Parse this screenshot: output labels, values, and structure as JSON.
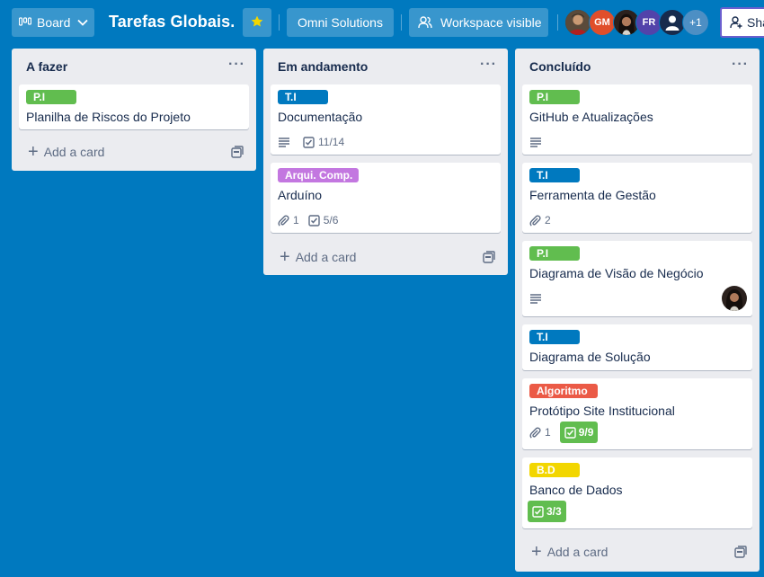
{
  "colors": {
    "board_bg": "#0079bf",
    "label_green": "#61bd4f",
    "label_blue": "#0079bf",
    "label_purple": "#c377e0",
    "label_red": "#eb5a46",
    "label_yellow": "#f2d600"
  },
  "header": {
    "view_label": "Board",
    "view_icon": "board-icon",
    "title": "Tarefas Globais.",
    "star_icon": "star-icon",
    "workspace": "Omni Solutions",
    "visibility": "Workspace visible",
    "visibility_icon": "people-icon",
    "members": [
      "GM",
      "FR"
    ],
    "more_members": "+1",
    "share": "Share"
  },
  "lists": [
    {
      "title": "A fazer",
      "add_card": "Add a card",
      "cards": [
        {
          "label": "P.I",
          "title": "Planilha de Riscos do Projeto"
        }
      ]
    },
    {
      "title": "Em andamento",
      "add_card": "Add a card",
      "cards": [
        {
          "label": "T.I",
          "title": "Documentação",
          "checklist": "11/14"
        },
        {
          "label": "Arqui. Comp.",
          "title": "Arduíno",
          "attachments": "1",
          "checklist": "5/6"
        }
      ]
    },
    {
      "title": "Concluído",
      "add_card": "Add a card",
      "cards": [
        {
          "label": "P.I",
          "title": "GitHub e Atualizações"
        },
        {
          "label": "T.I",
          "title": "Ferramenta de Gestão",
          "attachments": "2"
        },
        {
          "label": "P.I",
          "title": "Diagrama de Visão de Negócio"
        },
        {
          "label": "T.I",
          "title": "Diagrama de Solução"
        },
        {
          "label": "Algoritmo",
          "title": "Protótipo Site Institucional",
          "attachments": "1",
          "checklist": "9/9"
        },
        {
          "label": "B.D",
          "title": "Banco de Dados",
          "checklist": "3/3"
        }
      ]
    }
  ]
}
